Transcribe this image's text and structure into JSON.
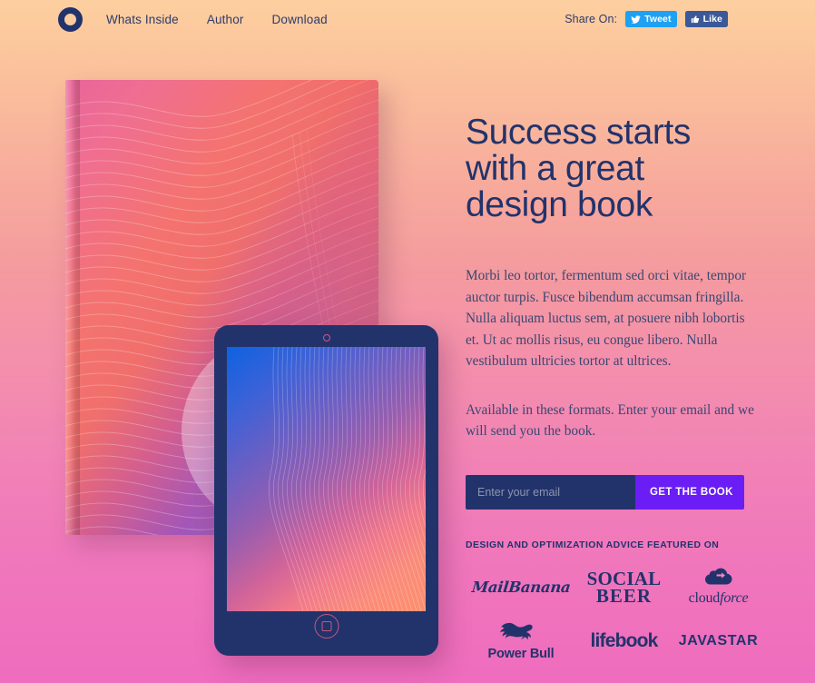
{
  "theme": {
    "navy": "#22336b",
    "cta_purple": "#6b1df5",
    "bg_top": "#fdcfa0",
    "bg_bottom": "#ef6cbe",
    "twitter_blue": "#1ea1f2",
    "facebook_blue": "#3b5998"
  },
  "header": {
    "logo_icon": "ring-logo-icon",
    "nav": [
      {
        "label": "Whats Inside"
      },
      {
        "label": "Author"
      },
      {
        "label": "Download"
      }
    ],
    "share": {
      "label": "Share On:",
      "tweet": {
        "label": "Tweet",
        "icon": "twitter-bird-icon"
      },
      "like": {
        "label": "Like",
        "icon": "thumbs-up-icon"
      }
    }
  },
  "hero": {
    "headline": "Success starts with a great design book",
    "paragraph": "Morbi leo tortor, fermentum sed orci vitae, tempor auctor turpis. Fusce bibendum accumsan fringilla. Nulla aliquam luctus sem, at posuere nibh lobortis et. Ut ac mollis risus, eu congue libero. Nulla vestibulum ultricies tortor at ultrices.",
    "formats_note": "Available in these formats. Enter your email and we will send you the book.",
    "form": {
      "email_placeholder": "Enter your email",
      "email_value": "",
      "submit_label": "GET THE BOOK"
    },
    "featured_label": "DESIGN AND OPTIMIZATION ADVICE FEATURED ON",
    "brands": [
      {
        "name": "MailBanana",
        "icon": "mailbanana-wordmark"
      },
      {
        "name_line1": "SOCIAL",
        "name_line2": "BEER",
        "icon": "socialbeer-wordmark"
      },
      {
        "name": "cloud",
        "name_italic": "force",
        "icon": "cloudforce-cloud-icon"
      },
      {
        "name_line1": "Power",
        "name_line2": "Bull",
        "icon": "powerbull-bull-icon"
      },
      {
        "name": "lifebook",
        "icon": "lifebook-wordmark"
      },
      {
        "name": "JAVASTAR",
        "icon": "javastar-wordmark"
      }
    ]
  },
  "visual": {
    "book": {
      "alt": "design book cover with gradient wave artwork"
    },
    "tablet": {
      "alt": "tablet showing gradient wave artwork",
      "camera": "camera-dot",
      "home": "home-button"
    }
  }
}
